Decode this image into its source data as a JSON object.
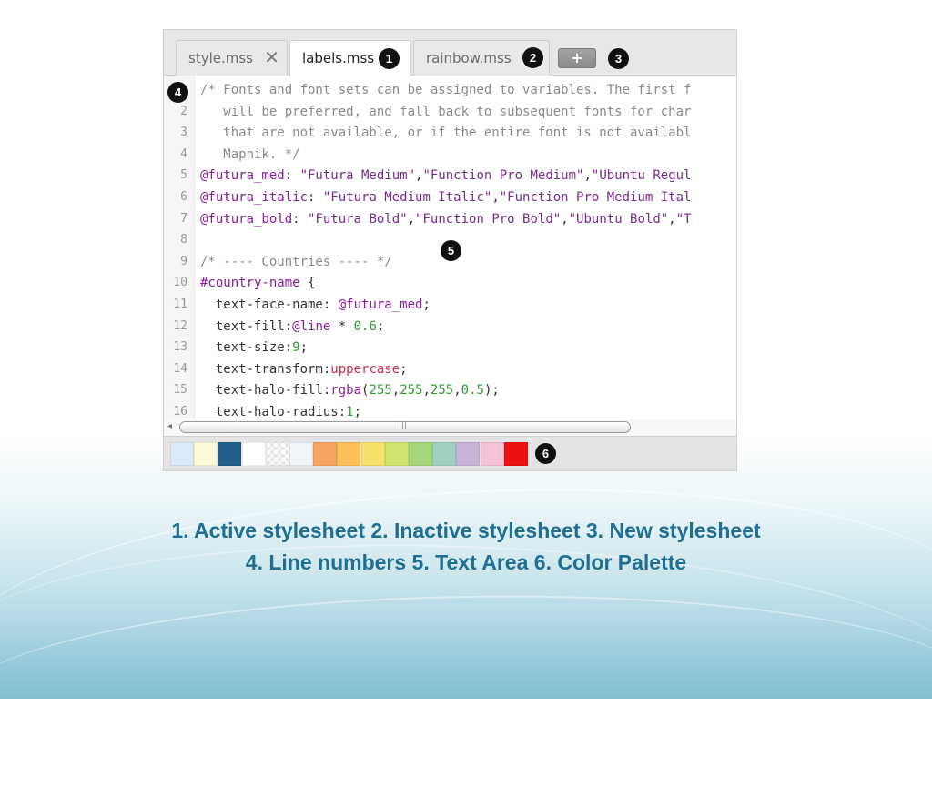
{
  "tabs": [
    {
      "label": "style.mss",
      "close": "✕",
      "state": "inactive"
    },
    {
      "label": "labels.mss",
      "state": "active"
    },
    {
      "label": "rainbow.mss",
      "state": "inactive"
    }
  ],
  "new_tab_button": "+",
  "badges": [
    "1",
    "2",
    "3",
    "4",
    "5",
    "6"
  ],
  "code_lines": [
    {
      "n": "",
      "html": "<span class=\"cm\">/* Fonts and font sets can be assigned to variables. The first f</span>"
    },
    {
      "n": "2",
      "html": "<span class=\"cm\">   will be preferred, and fall back to subsequent fonts for char</span>"
    },
    {
      "n": "3",
      "html": "<span class=\"cm\">   that are not available, or if the entire font is not availabl</span>"
    },
    {
      "n": "4",
      "html": "<span class=\"cm\">   Mapnik. */</span>"
    },
    {
      "n": "5",
      "html": "<span class=\"var\">@futura_med</span>: <span class=\"str\">\"Futura Medium\"</span>,<span class=\"str\">\"Function Pro Medium\"</span>,<span class=\"str\">\"Ubuntu Regul</span>"
    },
    {
      "n": "6",
      "html": "<span class=\"var\">@futura_italic</span>: <span class=\"str\">\"Futura Medium Italic\"</span>,<span class=\"str\">\"Function Pro Medium Ital</span>"
    },
    {
      "n": "7",
      "html": "<span class=\"var\">@futura_bold</span>: <span class=\"str\">\"Futura Bold\"</span>,<span class=\"str\">\"Function Pro Bold\"</span>,<span class=\"str\">\"Ubuntu Bold\"</span>,<span class=\"str\">\"T</span>"
    },
    {
      "n": "8",
      "html": ""
    },
    {
      "n": "9",
      "html": "<span class=\"cm\">/* ---- Countries ---- */</span>"
    },
    {
      "n": "10",
      "html": "<span class=\"sel\">#country-name</span> {"
    },
    {
      "n": "11",
      "html": "  text-face-name: <span class=\"var\">@futura_med</span>;"
    },
    {
      "n": "12",
      "html": "  text-fill:<span class=\"var\">@line</span> * <span class=\"num\">0.6</span>;"
    },
    {
      "n": "13",
      "html": "  text-size:<span class=\"num\">9</span>;"
    },
    {
      "n": "14",
      "html": "  text-transform:<span class=\"kw\">uppercase</span>;"
    },
    {
      "n": "15",
      "html": "  text-halo-fill:<span class=\"fn\">rgba</span>(<span class=\"num\">255</span>,<span class=\"num\">255</span>,<span class=\"num\">255</span>,<span class=\"num\">0.5</span>);"
    },
    {
      "n": "16",
      "html": "  text-halo-radius:<span class=\"num\">1</span>;"
    }
  ],
  "palette": [
    "#dbe9f8",
    "#fdf8d8",
    "#23618a",
    "#ffffff",
    "checker",
    "#eef4fb",
    "#f7a463",
    "#fbc05a",
    "#f8e06a",
    "#cfe36c",
    "#a6d77a",
    "#9fd1c3",
    "#c8b4d8",
    "#f4c2d6",
    "#ee1111"
  ],
  "caption": {
    "line1": "1. Active stylesheet 2. Inactive stylesheet 3. New stylesheet",
    "line2": "4. Line numbers 5. Text Area 6. Color Palette"
  }
}
